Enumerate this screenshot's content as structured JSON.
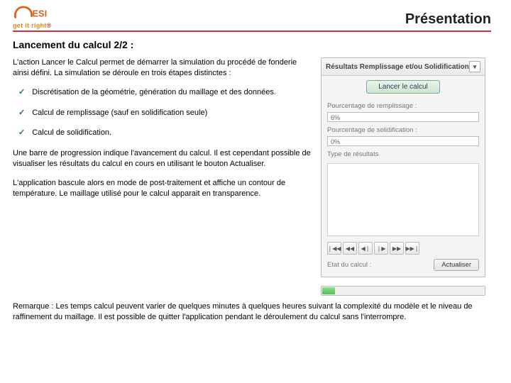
{
  "header": {
    "logo_tag": "get it right",
    "logo_mark_char": "®",
    "slide_title": "Présentation"
  },
  "section_title": "Lancement du calcul 2/2 :",
  "left": {
    "intro": "L'action Lancer le Calcul permet de démarrer la simulation du procédé de fonderie ainsi défini. La simulation se déroule en trois étapes distinctes :",
    "bullet1": "Discrétisation de la géométrie, génération du maillage et des données.",
    "bullet2": "Calcul de remplissage (sauf en solidification seule)",
    "bullet3": "Calcul de solidification.",
    "para2": "Une barre de progression indique l'avancement du calcul. Il est cependant possible de visualiser les résultats du calcul en cours en utilisant le bouton Actualiser.",
    "para3": "L'application bascule alors en mode de post-traitement et affiche un contour de température. Le maillage utilisé pour le calcul apparait en transparence."
  },
  "panel": {
    "title": "Résultats Remplissage et/ou Solidification",
    "launch_btn": "Lancer le calcul",
    "fill_pct_label": "Pourcentage de remplissage :",
    "fill_pct_value": "6%",
    "solid_pct_label": "Pourcentage de solidification :",
    "solid_pct_value": "0%",
    "result_type_label": "Type de résultats",
    "state_label": "Etat du calcul :",
    "refresh_btn": "Actualiser"
  },
  "remark": "Remarque : Les temps calcul peuvent varier de quelques minutes à quelques heures suivant la complexité du modèle et le niveau de raffinement du maillage. Il est possible de quitter l'application pendant le déroulement du calcul sans l'interrompre.",
  "icons": {
    "collapse": "▾",
    "first": "❘◀◀",
    "prev": "◀◀",
    "back": "◀❘",
    "fwd": "❘▶",
    "next": "▶▶",
    "last": "▶▶❘"
  }
}
